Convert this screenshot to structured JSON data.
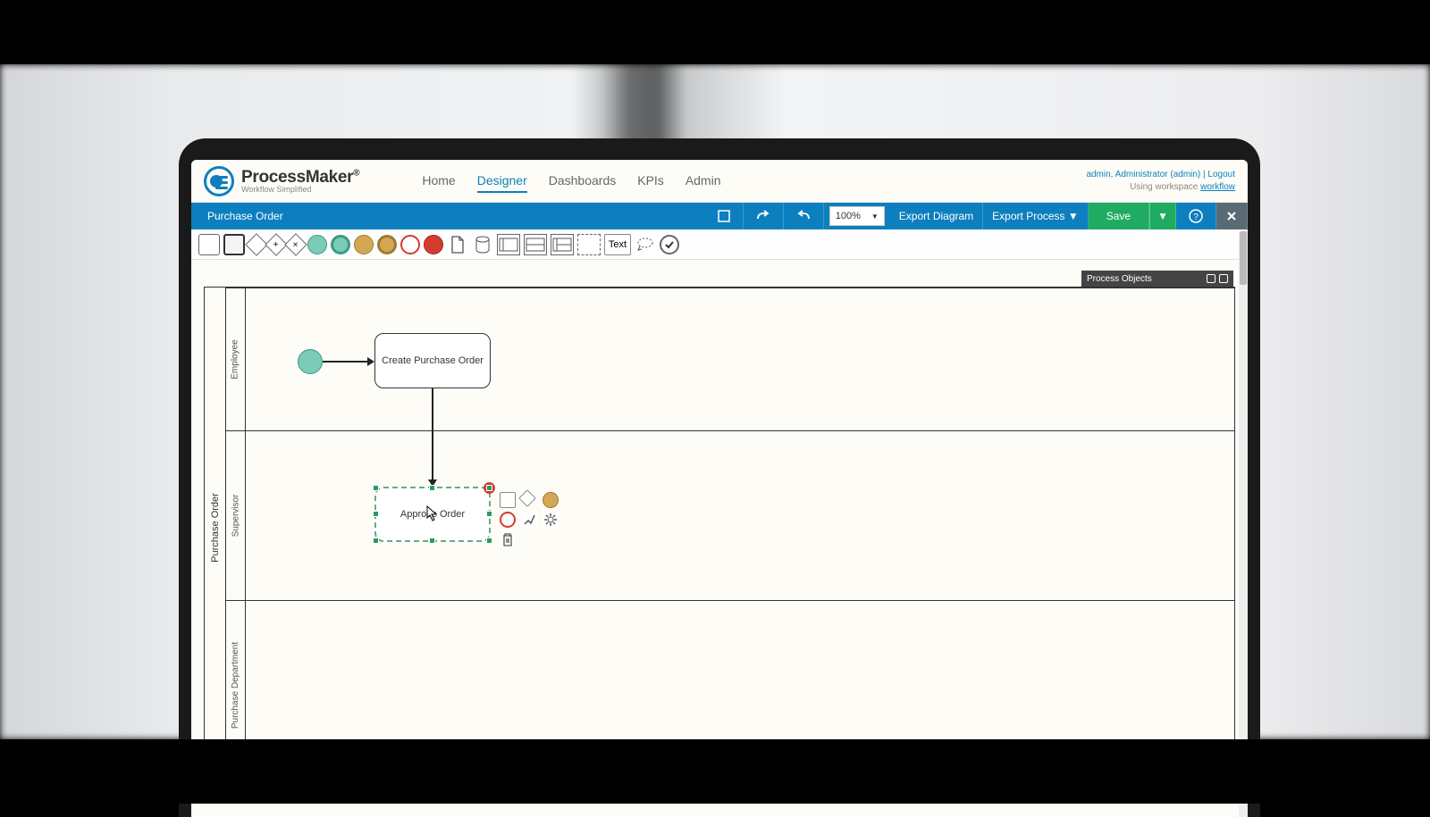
{
  "brand": {
    "name": "ProcessMaker",
    "sup": "®",
    "tagline": "Workflow Simplified"
  },
  "nav": {
    "items": [
      "Home",
      "Designer",
      "Dashboards",
      "KPIs",
      "Admin"
    ],
    "active": 1
  },
  "user": {
    "line1": "admin, Administrator (admin) | Logout",
    "workspace_prefix": "Using workspace ",
    "workspace": "workflow"
  },
  "bluebar": {
    "title": "Purchase Order",
    "zoom": "100%",
    "export_diagram": "Export Diagram",
    "export_process": "Export Process ▼",
    "save": "Save"
  },
  "toolbar_text": "Text",
  "panel_title": "Process Objects",
  "pool": {
    "title": "Purchase Order"
  },
  "lanes": [
    "Employee",
    "Supervisor",
    "Purchase Department"
  ],
  "tasks": {
    "create": "Create Purchase Order",
    "approve": "Approve Order"
  },
  "selected_badge": "1",
  "colors": {
    "primary": "#0d7fbe",
    "save": "#1fab62",
    "start_fill": "#7acbb8",
    "start_border": "#3a9b86",
    "badge": "#d43c2f"
  }
}
